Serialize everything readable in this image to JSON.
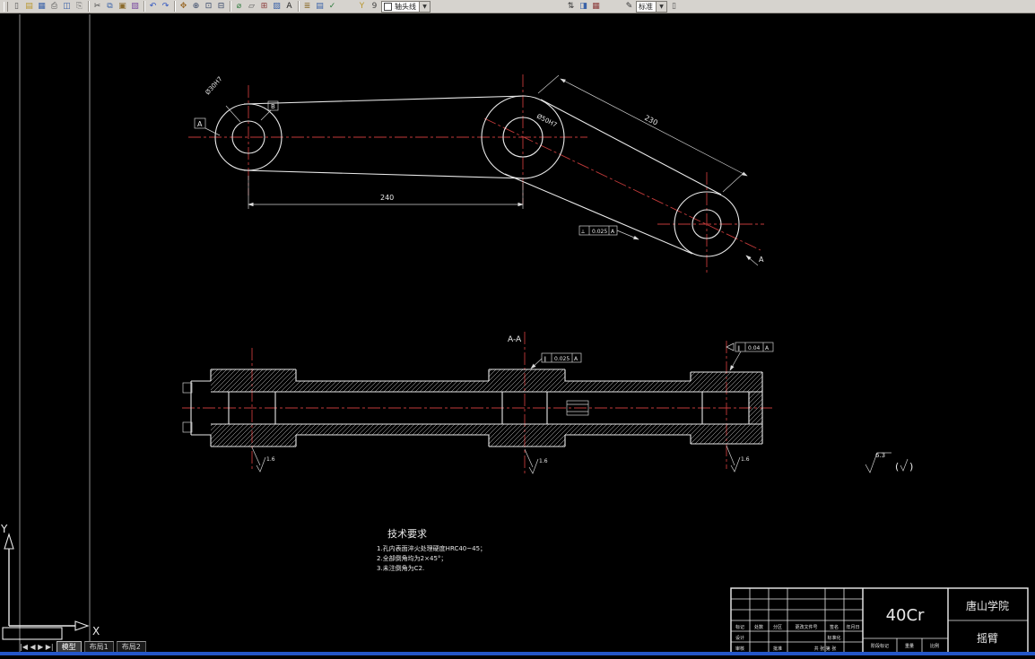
{
  "toolbar": {
    "items": [
      {
        "t": "h"
      },
      {
        "n": "new",
        "g": "▯",
        "c": "#555"
      },
      {
        "n": "open",
        "g": "▤",
        "c": "#b8962e"
      },
      {
        "n": "save",
        "g": "▦",
        "c": "#3a62a8"
      },
      {
        "n": "plot",
        "g": "⎙",
        "c": "#555"
      },
      {
        "n": "plot-preview",
        "g": "◫",
        "c": "#3a62a8"
      },
      {
        "n": "publish",
        "g": "⎘",
        "c": "#777"
      },
      {
        "t": "s"
      },
      {
        "n": "cut",
        "g": "✂",
        "c": "#444"
      },
      {
        "n": "copy",
        "g": "⧉",
        "c": "#3a62a8"
      },
      {
        "n": "paste",
        "g": "▣",
        "c": "#8a6a2a"
      },
      {
        "n": "match-properties",
        "g": "▧",
        "c": "#7a4aa0"
      },
      {
        "t": "s"
      },
      {
        "n": "undo",
        "g": "↶",
        "c": "#2a52c0"
      },
      {
        "n": "redo",
        "g": "↷",
        "c": "#2a52c0"
      },
      {
        "t": "s"
      },
      {
        "n": "pan",
        "g": "✥",
        "c": "#9a6a2a"
      },
      {
        "n": "zoom-realtime",
        "g": "⊕",
        "c": "#334466"
      },
      {
        "n": "zoom-window",
        "g": "⊡",
        "c": "#334466"
      },
      {
        "n": "zoom-previous",
        "g": "⊟",
        "c": "#334466"
      },
      {
        "t": "s"
      },
      {
        "n": "distance",
        "g": "⌀",
        "c": "#2a7a3a"
      },
      {
        "n": "region",
        "g": "▱",
        "c": "#555"
      },
      {
        "n": "block",
        "g": "⊞",
        "c": "#8a3a3a"
      },
      {
        "n": "hatch",
        "g": "▨",
        "c": "#3a62a8"
      },
      {
        "n": "text",
        "g": "A",
        "c": "#222"
      },
      {
        "t": "s"
      },
      {
        "n": "layer-properties",
        "g": "≣",
        "c": "#8a6a2a"
      },
      {
        "n": "layer-states",
        "g": "▤",
        "c": "#3a62a8"
      },
      {
        "n": "make-layer-current",
        "g": "✓",
        "c": "#2a7a3a"
      },
      {
        "t": "g",
        "w": 18
      },
      {
        "n": "layer-filter",
        "g": "Y",
        "c": "#b8962e"
      },
      {
        "n": "layer-lock",
        "g": "9",
        "c": "#444"
      },
      {
        "t": "c2",
        "n": "layer-combo",
        "bind": "toolbar.layer_combo"
      },
      {
        "t": "g",
        "w": 148
      },
      {
        "n": "spin-arrows",
        "g": "⇅",
        "c": "#333"
      },
      {
        "n": "properties",
        "g": "◨",
        "c": "#3a62a8"
      },
      {
        "n": "toolbox",
        "g": "▦",
        "c": "#8a3a3a"
      },
      {
        "t": "g",
        "w": 22
      },
      {
        "n": "style-edit",
        "g": "✎",
        "c": "#333"
      },
      {
        "t": "c",
        "n": "style-combo",
        "bind": "toolbar.style_combo"
      },
      {
        "n": "sheet",
        "g": "▯",
        "c": "#555"
      }
    ],
    "layer_combo": "轴头线",
    "style_combo": "标准",
    "dropdown_glyph": "▼"
  },
  "drawing": {
    "dim": {
      "d1": "240",
      "d2": "230",
      "dia1": "Ø30H7",
      "dia2": "Ø50H7"
    },
    "datum": {
      "a": "A",
      "b": "B"
    },
    "section": {
      "title": "A-A",
      "letter": "A"
    },
    "tol": {
      "t1": {
        "sym": "⟂",
        "val": "0.025",
        "ref": "A"
      },
      "t2": {
        "sym": "∥",
        "val": "0.025",
        "ref": "A"
      },
      "t3": {
        "sym": "∥",
        "val": "0.04",
        "ref": "A"
      }
    },
    "rough": {
      "r1": "1.6",
      "r2": "1.6",
      "r3": "1.6",
      "rest": "6.3"
    },
    "tech": {
      "title": "技术要求",
      "l1": "1.孔内表面淬火处理硬度HRC40~45；",
      "l2": "2.全部倒角均为2×45°；",
      "l3": "3.未注倒角为C2."
    }
  },
  "title_block": {
    "material": "40Cr",
    "school": "唐山学院",
    "part": "摇臂",
    "labels": {
      "biaoji": "标记",
      "chushu": "处数",
      "fenqu": "分区",
      "genggai": "更改文件号",
      "qianming": "签名",
      "riqi": "年月日",
      "sheji": "设计",
      "biaozhunhua": "标准化",
      "shenhe": "审核",
      "pizhun": "批准",
      "jieduan": "阶段标记",
      "zhongliang": "重量",
      "bili": "比例",
      "zhang": "共 张 第 张"
    }
  },
  "ucs": {
    "x": "X",
    "y": "Y"
  },
  "tabs": {
    "nav": "|◀ ◀ ▶ ▶|",
    "model": "模型",
    "layout1": "布局1",
    "layout2": "布局2"
  }
}
